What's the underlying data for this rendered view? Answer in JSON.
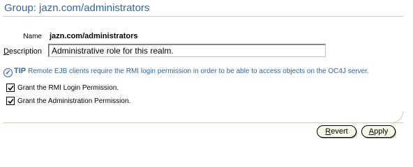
{
  "header": {
    "title": "Group: jazn.com/administrators"
  },
  "form": {
    "name_label": "Name",
    "name_value": "jazn.com/administrators",
    "description_label_accesskey": "D",
    "description_label_rest": "escription",
    "description_value": "Administrative role for this realm."
  },
  "tip": {
    "label": "TIP",
    "text": "Remote EJB clients require the RMI login permission in order to be able to access objects on the OC4J server."
  },
  "permissions": [
    {
      "label": "Grant the RMI Login Permission.",
      "checked": true
    },
    {
      "label": "Grant the Administration Permission.",
      "checked": true
    }
  ],
  "buttons": {
    "revert_accesskey": "R",
    "revert_rest": "evert",
    "apply_accesskey": "A",
    "apply_rest": "pply"
  },
  "colors": {
    "accent": "#336699",
    "rule": "#c8cbb0",
    "button_bg": "#f7f7e7"
  },
  "icons": {
    "tip": "info-check-icon",
    "checkbox": "checkmark-icon"
  }
}
